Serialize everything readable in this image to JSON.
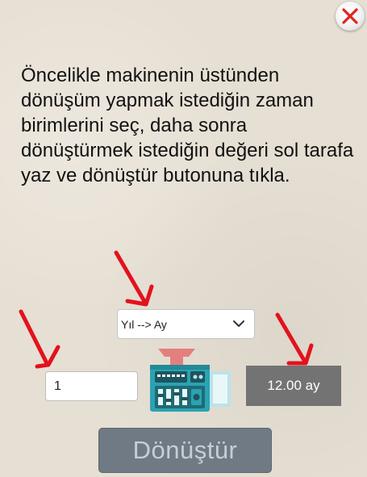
{
  "instructions": "Öncelikle makinenin üstünden dönüşüm yapmak istediğin zaman birimlerini seç, daha sonra dönüştürmek istediğin değeri sol tarafa yaz ve dönüştür butonuna tıkla.",
  "converter": {
    "unit_select": {
      "selected": "Yıl --> Ay"
    },
    "input_value": "1",
    "result": "12.00 ay",
    "convert_label": "Dönüştür"
  },
  "icons": {
    "close": "close-x-icon",
    "arrows": "red-arrow-icon",
    "dropdown": "chevron-down-icon",
    "machine": "converter-machine-icon"
  },
  "colors": {
    "background": "#e6dfd3",
    "arrow_red": "#e3121d",
    "close_red": "#e32222",
    "result_bg": "#737373",
    "button_bg": "#6f7a84",
    "machine_teal": "#2ba3b2",
    "machine_funnel": "#e47f7f"
  }
}
